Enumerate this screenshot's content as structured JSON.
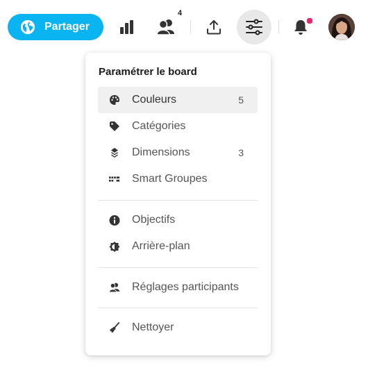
{
  "toolbar": {
    "share_label": "Partager",
    "participants_count": "4",
    "colors": {
      "accent": "#0ab4f0",
      "notification_dot": "#e8246e",
      "settings_active_bg": "#e8e8e8"
    }
  },
  "menu": {
    "title": "Paramétrer le board",
    "groups": [
      [
        {
          "icon": "palette-icon",
          "label": "Couleurs",
          "count": "5",
          "active": true
        },
        {
          "icon": "tag-icon",
          "label": "Catégories",
          "count": ""
        },
        {
          "icon": "layers-icon",
          "label": "Dimensions",
          "count": "3"
        },
        {
          "icon": "grid-icon",
          "label": "Smart Groupes",
          "count": ""
        }
      ],
      [
        {
          "icon": "info-icon",
          "label": "Objectifs"
        },
        {
          "icon": "contrast-icon",
          "label": "Arrière-plan"
        }
      ],
      [
        {
          "icon": "users-icon",
          "label": "Réglages participants"
        }
      ],
      [
        {
          "icon": "broom-icon",
          "label": "Nettoyer"
        }
      ]
    ]
  }
}
